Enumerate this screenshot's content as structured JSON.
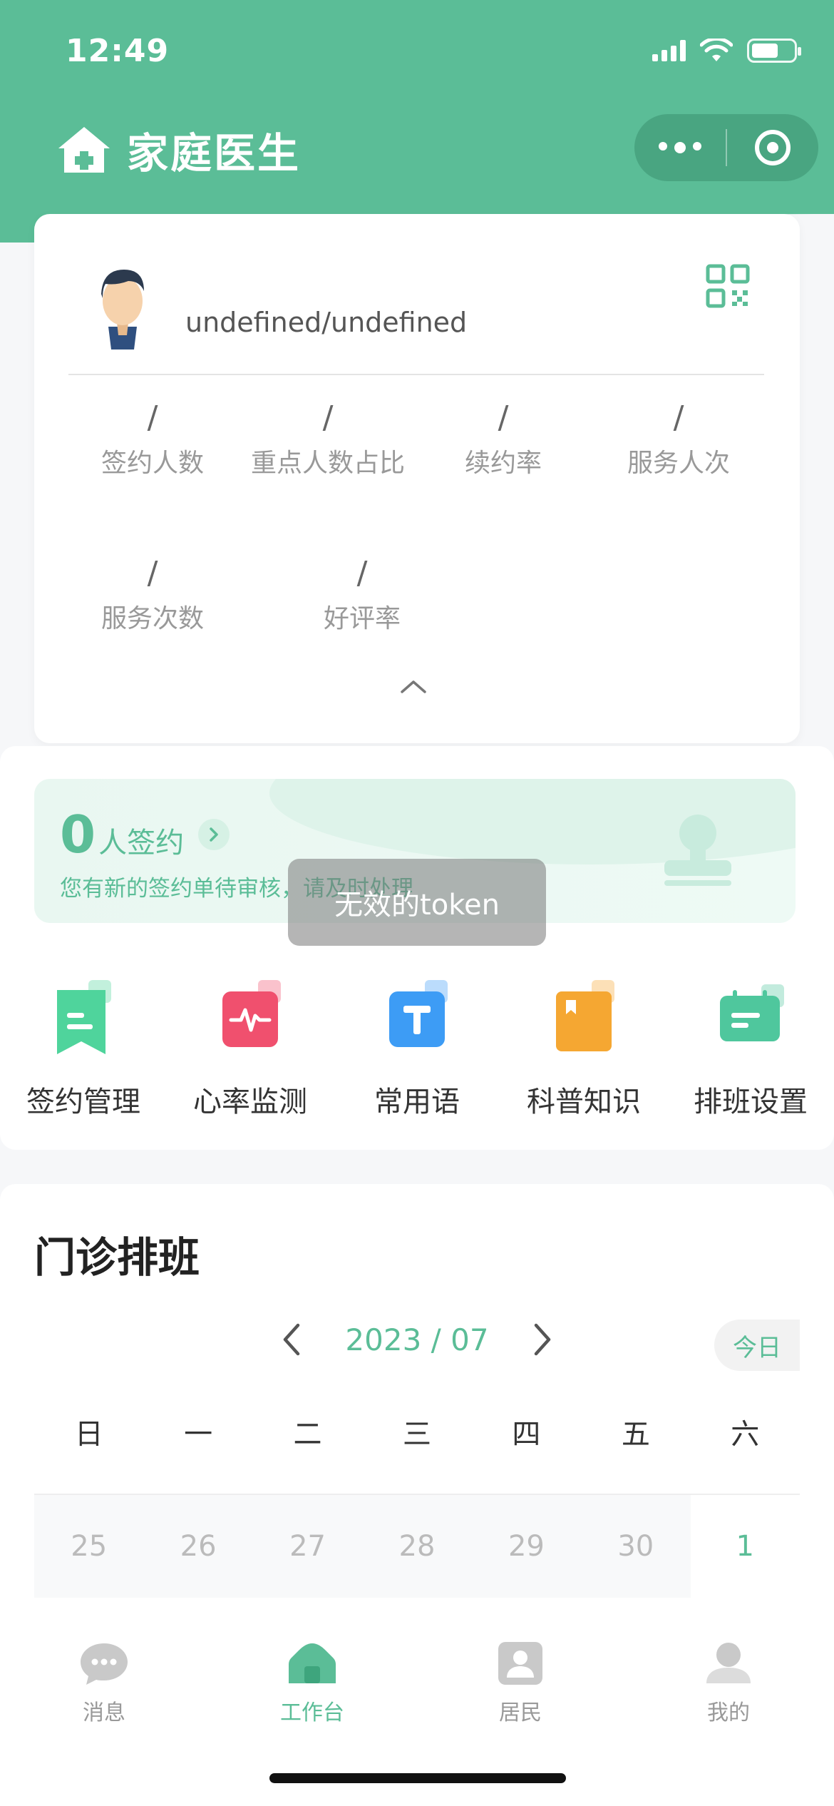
{
  "status_bar": {
    "time": "12:49"
  },
  "header": {
    "title": "家庭医生"
  },
  "profile": {
    "name": "undefined/undefined",
    "stats": [
      {
        "value": "/",
        "label": "签约人数"
      },
      {
        "value": "/",
        "label": "重点人数占比"
      },
      {
        "value": "/",
        "label": "续约率"
      },
      {
        "value": "/",
        "label": "服务人次"
      },
      {
        "value": "/",
        "label": "服务次数"
      },
      {
        "value": "/",
        "label": "好评率"
      }
    ]
  },
  "sign_banner": {
    "count": "0",
    "unit": "人签约",
    "tip": "您有新的签约单待审核，请及时处理"
  },
  "toast": {
    "message": "无效的token"
  },
  "functions": [
    {
      "label": "签约管理",
      "icon": "bookmark-icon",
      "color": "#4fd49c"
    },
    {
      "label": "心率监测",
      "icon": "heartbeat-icon",
      "color": "#f0506e"
    },
    {
      "label": "常用语",
      "icon": "text-icon",
      "color": "#3d9cf5"
    },
    {
      "label": "科普知识",
      "icon": "book-icon",
      "color": "#f5a732"
    },
    {
      "label": "排班设置",
      "icon": "calendar-icon",
      "color": "#4fc79d"
    }
  ],
  "schedule": {
    "title": "门诊排班",
    "month": "2023 / 07",
    "today_label": "今日",
    "weekdays": [
      "日",
      "一",
      "二",
      "三",
      "四",
      "五",
      "六"
    ],
    "dates": [
      "25",
      "26",
      "27",
      "28",
      "29",
      "30",
      "1"
    ]
  },
  "tabbar": {
    "items": [
      {
        "label": "消息",
        "icon": "message-icon"
      },
      {
        "label": "工作台",
        "icon": "home-icon",
        "active": true
      },
      {
        "label": "居民",
        "icon": "contact-icon"
      },
      {
        "label": "我的",
        "icon": "user-icon"
      }
    ]
  },
  "colors": {
    "primary": "#5bbd97",
    "background": "#f6f7f9"
  }
}
